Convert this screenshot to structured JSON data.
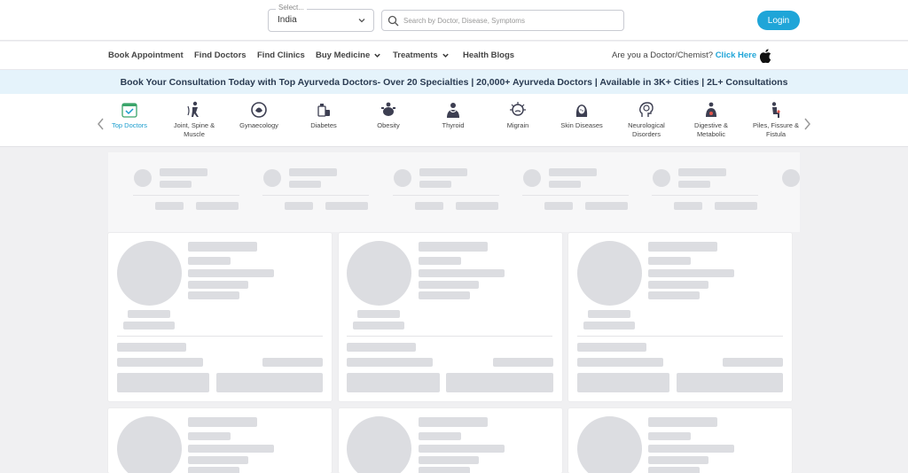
{
  "header": {
    "country_label": "Select...",
    "country_value": "India",
    "search_placeholder": "Search by Doctor, Disease, Symptoms",
    "login_label": "Login"
  },
  "nav": {
    "items": [
      {
        "label": "Book Appointment"
      },
      {
        "label": "Find Doctors"
      },
      {
        "label": "Find Clinics"
      },
      {
        "label": "Buy Medicine"
      },
      {
        "label": "Treatments"
      },
      {
        "label": "Health Blogs"
      }
    ],
    "doctor_prompt": "Are you a Doctor/Chemist?",
    "doctor_link": "Click Here"
  },
  "banner": {
    "text": "Book Your Consultation Today with Top Ayurveda Doctors- Over 20 Specialties | 20,000+ Ayurveda Doctors | Available in 3K+ Cities | 2L+ Consultations"
  },
  "specialties": [
    {
      "label": "Top Doctors",
      "icon": "doctor-icon"
    },
    {
      "label": "Joint, Spine & Muscle",
      "icon": "spine-icon"
    },
    {
      "label": "Gynaecology",
      "icon": "gynaecology-icon"
    },
    {
      "label": "Diabetes",
      "icon": "diabetes-icon"
    },
    {
      "label": "Obesity",
      "icon": "obesity-icon"
    },
    {
      "label": "Thyroid",
      "icon": "thyroid-icon"
    },
    {
      "label": "Migrain",
      "icon": "migraine-icon"
    },
    {
      "label": "Skin Diseases",
      "icon": "skin-icon"
    },
    {
      "label": "Neurological Disorders",
      "icon": "brain-icon"
    },
    {
      "label": "Digestive & Metabolic",
      "icon": "digestive-icon"
    },
    {
      "label": "Piles, Fissure & Fistula",
      "icon": "piles-icon"
    }
  ],
  "colors": {
    "accent": "#1fa5d8",
    "banner_bg": "#e5f3fb",
    "skeleton": "#dcdde1"
  }
}
